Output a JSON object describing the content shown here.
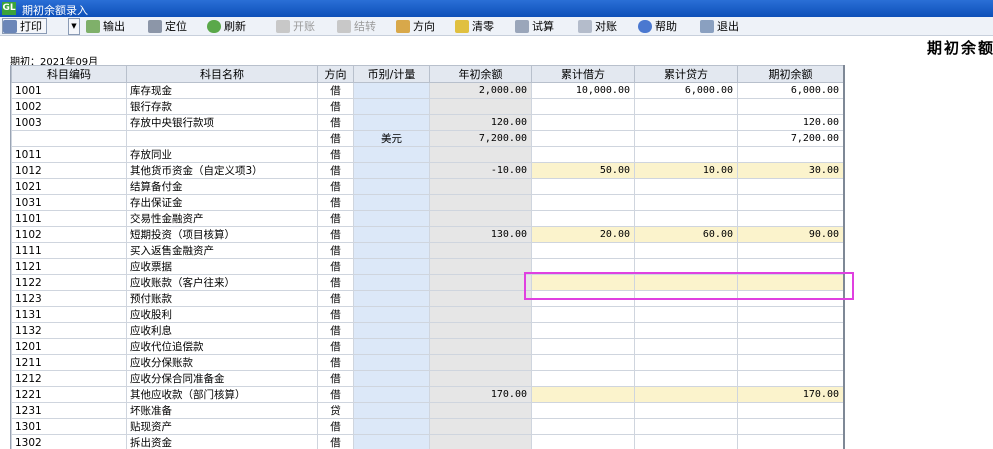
{
  "window": {
    "app_icon": "GL",
    "title": "期初余额录入"
  },
  "toolbar": {
    "print": "打印",
    "export": "输出",
    "locate": "定位",
    "refresh": "刷新",
    "open_account": "开账",
    "carry_over": "结转",
    "direction": "方向",
    "clear": "清零",
    "trial": "试算",
    "reconcile": "对账",
    "help": "帮助",
    "exit": "退出"
  },
  "page_title": "期初余额",
  "period": "期初：2021年09月",
  "columns": [
    "科目编码",
    "科目名称",
    "方向",
    "币别/计量",
    "年初余额",
    "累计借方",
    "累计贷方",
    "期初余额"
  ],
  "rows": [
    {
      "code": "1001",
      "name": "库存现金",
      "dir": "借",
      "cur": "",
      "open": "2,000.00",
      "debit": "10,000.00",
      "credit": "6,000.00",
      "begin": "6,000.00",
      "yel": false
    },
    {
      "code": "1002",
      "name": "银行存款",
      "dir": "借",
      "cur": "",
      "open": "",
      "debit": "",
      "credit": "",
      "begin": "",
      "yel": false
    },
    {
      "code": "1003",
      "name": "存放中央银行款项",
      "dir": "借",
      "cur": "",
      "open": "120.00",
      "debit": "",
      "credit": "",
      "begin": "120.00",
      "yel": false
    },
    {
      "code": "",
      "name": "",
      "dir": "借",
      "cur": "美元",
      "open": "7,200.00",
      "debit": "",
      "credit": "",
      "begin": "7,200.00",
      "yel": false
    },
    {
      "code": "1011",
      "name": "存放同业",
      "dir": "借",
      "cur": "",
      "open": "",
      "debit": "",
      "credit": "",
      "begin": "",
      "yel": false
    },
    {
      "code": "1012",
      "name": "其他货币资金（自定义项3）",
      "dir": "借",
      "cur": "",
      "open": "-10.00",
      "debit": "50.00",
      "credit": "10.00",
      "begin": "30.00",
      "yel": true
    },
    {
      "code": "1021",
      "name": "结算备付金",
      "dir": "借",
      "cur": "",
      "open": "",
      "debit": "",
      "credit": "",
      "begin": "",
      "yel": false
    },
    {
      "code": "1031",
      "name": "存出保证金",
      "dir": "借",
      "cur": "",
      "open": "",
      "debit": "",
      "credit": "",
      "begin": "",
      "yel": false
    },
    {
      "code": "1101",
      "name": "交易性金融资产",
      "dir": "借",
      "cur": "",
      "open": "",
      "debit": "",
      "credit": "",
      "begin": "",
      "yel": false
    },
    {
      "code": "1102",
      "name": "短期投资（项目核算）",
      "dir": "借",
      "cur": "",
      "open": "130.00",
      "debit": "20.00",
      "credit": "60.00",
      "begin": "90.00",
      "yel": true
    },
    {
      "code": "1111",
      "name": "买入返售金融资产",
      "dir": "借",
      "cur": "",
      "open": "",
      "debit": "",
      "credit": "",
      "begin": "",
      "yel": false
    },
    {
      "code": "1121",
      "name": "应收票据",
      "dir": "借",
      "cur": "",
      "open": "",
      "debit": "",
      "credit": "",
      "begin": "",
      "yel": false
    },
    {
      "code": "1122",
      "name": "应收账款（客户往来）",
      "dir": "借",
      "cur": "",
      "open": "",
      "debit": "",
      "credit": "",
      "begin": "",
      "yel": true
    },
    {
      "code": "1123",
      "name": "预付账款",
      "dir": "借",
      "cur": "",
      "open": "",
      "debit": "",
      "credit": "",
      "begin": "",
      "yel": false
    },
    {
      "code": "1131",
      "name": "应收股利",
      "dir": "借",
      "cur": "",
      "open": "",
      "debit": "",
      "credit": "",
      "begin": "",
      "yel": false
    },
    {
      "code": "1132",
      "name": "应收利息",
      "dir": "借",
      "cur": "",
      "open": "",
      "debit": "",
      "credit": "",
      "begin": "",
      "yel": false
    },
    {
      "code": "1201",
      "name": "应收代位追偿款",
      "dir": "借",
      "cur": "",
      "open": "",
      "debit": "",
      "credit": "",
      "begin": "",
      "yel": false
    },
    {
      "code": "1211",
      "name": "应收分保账款",
      "dir": "借",
      "cur": "",
      "open": "",
      "debit": "",
      "credit": "",
      "begin": "",
      "yel": false
    },
    {
      "code": "1212",
      "name": "应收分保合同准备金",
      "dir": "借",
      "cur": "",
      "open": "",
      "debit": "",
      "credit": "",
      "begin": "",
      "yel": false
    },
    {
      "code": "1221",
      "name": "其他应收款（部门核算）",
      "dir": "借",
      "cur": "",
      "open": "170.00",
      "debit": "",
      "credit": "",
      "begin": "170.00",
      "yel": true
    },
    {
      "code": "1231",
      "name": "坏账准备",
      "dir": "贷",
      "cur": "",
      "open": "",
      "debit": "",
      "credit": "",
      "begin": "",
      "yel": false
    },
    {
      "code": "1301",
      "name": "贴现资产",
      "dir": "借",
      "cur": "",
      "open": "",
      "debit": "",
      "credit": "",
      "begin": "",
      "yel": false
    },
    {
      "code": "1302",
      "name": "拆出资金",
      "dir": "借",
      "cur": "",
      "open": "",
      "debit": "",
      "credit": "",
      "begin": "",
      "yel": false
    }
  ]
}
